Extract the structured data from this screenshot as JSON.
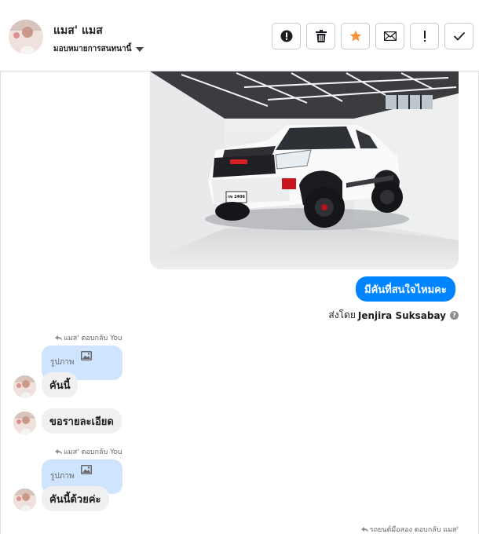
{
  "header": {
    "contact_name": "แมส' แมส",
    "assign_label": "มอบหมายการสนทนานี้",
    "icons": [
      "alert-circle-icon",
      "trash-icon",
      "star-icon",
      "mail-icon",
      "exclamation-icon",
      "check-icon"
    ],
    "star_color": "#f7923a"
  },
  "messages": {
    "outgoing_text": "มีคันที่สนใจไหมคะ",
    "sent_by_prefix": "ส่งโดย",
    "sent_by_name": "Jenjira Suksabay",
    "reply_note_1": "แมส' ตอบกลับ You",
    "quote_1_label": "รูปภาพ",
    "incoming_1": "คันนี้",
    "incoming_2": "ขอรายละเอียด",
    "reply_note_2": "แมส' ตอบกลับ You",
    "quote_2_label": "รูปภาพ",
    "incoming_3": "คันนี้ด้วยค่ะ",
    "footer_note": "รถยนต์มือสอง ตอบกลับ แมส'"
  },
  "photo": {
    "plate_text": "กษ 2406"
  },
  "colors": {
    "accent": "#0084ff",
    "quote_bg": "#cfe4ff",
    "incoming_bg": "#f0f0f0"
  }
}
